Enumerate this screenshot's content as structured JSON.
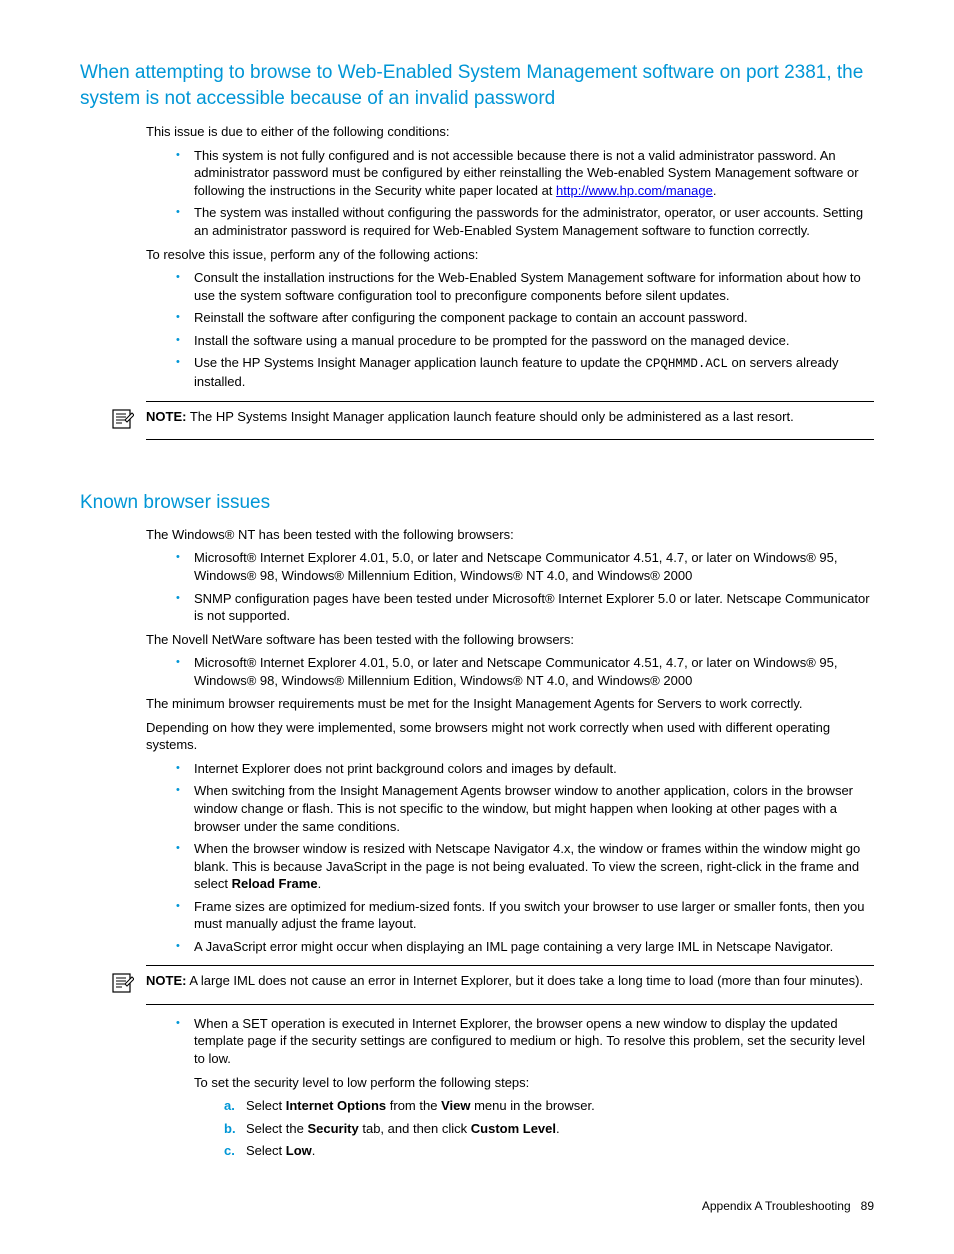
{
  "section1": {
    "heading": "When attempting to browse to Web-Enabled System Management software on port 2381, the system is not accessible because of an invalid password",
    "intro": "This issue is due to either of the following conditions:",
    "cond1a": "This system is not fully configured and is not accessible because there is not a valid administrator password. An administrator password must be configured by either reinstalling the Web-enabled System Management software or following the instructions in the Security white paper located at ",
    "cond1_link": "http://www.hp.com/manage",
    "cond1b": ".",
    "cond2": "The system was installed without configuring the passwords for the administrator, operator, or user accounts. Setting an administrator password is required for Web-Enabled System Management software to function correctly.",
    "resolve_intro": "To resolve this issue, perform any of the following actions:",
    "action1": "Consult the installation instructions for the Web-Enabled System Management software for information about how to use the system software configuration tool to preconfigure components before silent updates.",
    "action2": "Reinstall the software after configuring the component package to contain an account password.",
    "action3": "Install the software using a manual procedure to be prompted for the password on the managed device.",
    "action4a": "Use the HP Systems Insight Manager application launch feature to update the ",
    "action4_code": "CPQHMMD.ACL",
    "action4b": " on servers already installed.",
    "note_label": "NOTE:",
    "note_text": "  The HP Systems Insight Manager application launch feature should only be administered as a last resort."
  },
  "section2": {
    "heading": "Known browser issues",
    "intro": "The Windows® NT has been tested with the following browsers:",
    "b1": "Microsoft® Internet Explorer 4.01, 5.0, or later and Netscape Communicator 4.51, 4.7, or later on Windows® 95, Windows® 98, Windows® Millennium Edition, Windows® NT 4.0, and Windows® 2000",
    "b2": "SNMP configuration pages have been tested under Microsoft® Internet Explorer 5.0 or later. Netscape Communicator is not supported.",
    "novell": "The Novell NetWare software has been tested with the following browsers:",
    "n1": "Microsoft® Internet Explorer 4.01, 5.0, or later and Netscape Communicator 4.51, 4.7, or later on Windows® 95, Windows® 98, Windows® Millennium Edition, Windows® NT 4.0, and Windows® 2000",
    "min": "The minimum browser requirements must be met for the Insight Management Agents for Servers to work correctly.",
    "depend": "Depending on how they were implemented, some browsers might not work correctly when used with different operating systems.",
    "i1": "Internet Explorer does not print background colors and images by default.",
    "i2": "When switching from the Insight Management Agents browser window to another application, colors in the browser window change or flash. This is not specific to the window, but might happen when looking at other pages with a browser under the same conditions.",
    "i3a": "When the browser window is resized with Netscape Navigator 4.x, the window or frames within the window might go blank. This is because JavaScript in the page is not being evaluated. To view the screen, right-click in the frame and select ",
    "i3_bold": "Reload Frame",
    "i3b": ".",
    "i4": "Frame sizes are optimized for medium-sized fonts. If you switch your browser to use larger or smaller fonts, then you must manually adjust the frame layout.",
    "i5": "A JavaScript error might occur when displaying an IML page containing a very large IML in Netscape Navigator.",
    "note_label": "NOTE:",
    "note_text": "  A large IML does not cause an error in Internet Explorer, but it does take a long time to load (more than four minutes).",
    "set1": "When a SET operation is executed in Internet Explorer, the browser opens a new window to display the updated template page if the security settings are configured to medium or high. To resolve this problem, set the security level to low.",
    "set2": "To set the security level to low perform the following steps:",
    "step_a_pre": "Select ",
    "step_a_b1": "Internet Options",
    "step_a_mid": " from the ",
    "step_a_b2": "View",
    "step_a_post": " menu in the browser.",
    "step_b_pre": "Select the ",
    "step_b_b1": "Security",
    "step_b_mid": " tab, and then click ",
    "step_b_b2": "Custom Level",
    "step_b_post": ".",
    "step_c_pre": "Select ",
    "step_c_b1": "Low",
    "step_c_post": "."
  },
  "footer": {
    "label": "Appendix A Troubleshooting",
    "page": "89"
  }
}
